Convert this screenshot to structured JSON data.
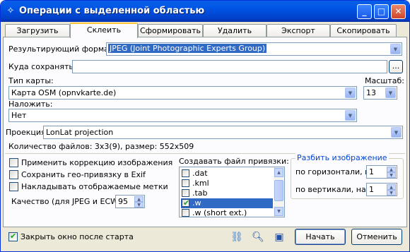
{
  "window": {
    "title": "Операции с выделенной областью",
    "icons": {
      "app": "compass-icon",
      "min": "minimize-icon",
      "max": "maximize-icon",
      "close": "close-icon"
    }
  },
  "tabs": [
    {
      "label": "Загрузить"
    },
    {
      "label": "Склеить"
    },
    {
      "label": "Сформировать"
    },
    {
      "label": "Удалить"
    },
    {
      "label": "Экспорт"
    },
    {
      "label": "Скопировать"
    }
  ],
  "form": {
    "format_label": "Результирующий формат:",
    "format_value": "JPEG (Joint Photographic Experts Group)",
    "save_label": "Куда сохранять:",
    "save_value": "",
    "browse_label": "...",
    "map_type_label": "Тип карты:",
    "map_type_value": "Карта OSM (opnvkarte.de)",
    "scale_label": "Масштаб:",
    "scale_value": "13",
    "overlay_label": "Наложить:",
    "overlay_value": "Нет",
    "projection_label": "Проекция:",
    "projection_value": "LonLat projection",
    "files_info": "Количество файлов: 3x3(9), размер: 552x509"
  },
  "options": {
    "color_correction": "Применить коррекцию изображения",
    "save_georef_exif": "Сохранить гео-привязку в Exif",
    "overlay_marks": "Накладывать отображаемые метки",
    "quality_label": "Качество (для JPEG и ECW):",
    "quality_value": "95"
  },
  "georef": {
    "label": "Создавать файл привязки:",
    "items": [
      {
        "label": ".dat",
        "checked": false
      },
      {
        "label": ".kml",
        "checked": false
      },
      {
        "label": ".tab",
        "checked": false
      },
      {
        "label": ".w",
        "checked": true
      },
      {
        "label": ".w (short ext.)",
        "checked": false
      }
    ]
  },
  "split": {
    "title": "Разбить изображение",
    "horiz_label": "по горизонтали, на",
    "horiz_value": "1",
    "vert_label": "по вертикали, на",
    "vert_value": "1"
  },
  "footer": {
    "close_after_start": "Закрыть окно после старта",
    "start_label": "Начать",
    "cancel_label": "Отменить",
    "icons": [
      "link-icon",
      "zoom-icon",
      "save-icon"
    ]
  }
}
